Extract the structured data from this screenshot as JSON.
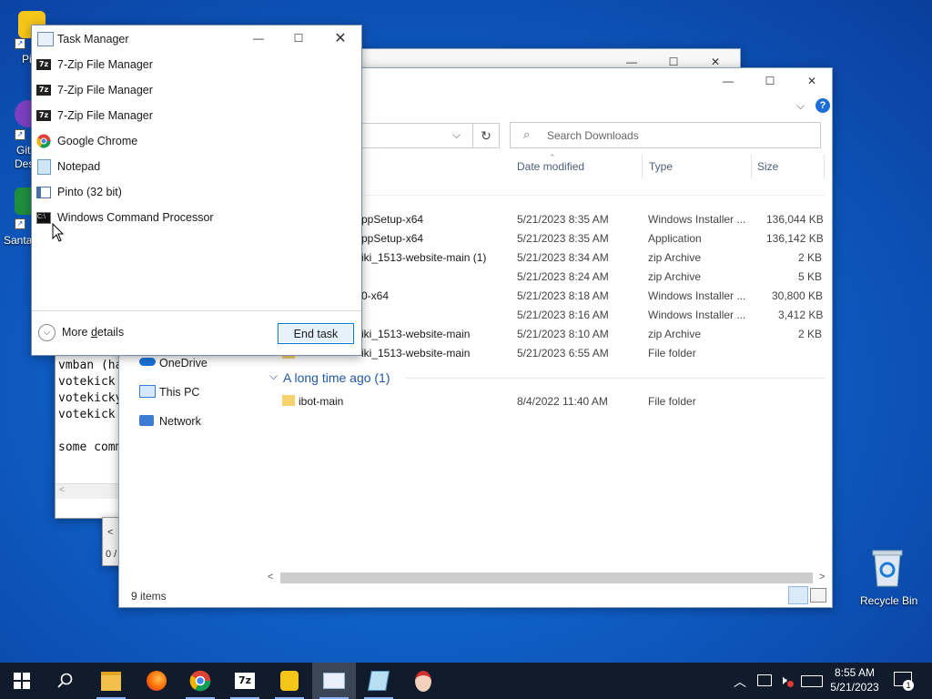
{
  "desktop": {
    "icons": [
      {
        "label": "Pi"
      },
      {
        "label": "Git"
      },
      {
        "label": "Des"
      },
      {
        "label": "Santa"
      },
      {
        "label": "Recycle Bin"
      }
    ]
  },
  "explorer_back": {
    "title": ""
  },
  "notepad": {
    "lines": [
      "vmban (ha",
      "votekick",
      "votekicky",
      "votekick",
      "",
      "some comm"
    ],
    "status": "0 /"
  },
  "explorer": {
    "search_placeholder": "Search Downloads",
    "columns": [
      "Date modified",
      "Type",
      "Size"
    ],
    "rows": [
      {
        "name": "ppSetup-x64",
        "date": "5/21/2023 8:35 AM",
        "type": "Windows Installer ...",
        "size": "136,044 KB"
      },
      {
        "name": "ppSetup-x64",
        "date": "5/21/2023 8:35 AM",
        "type": "Application",
        "size": "136,142 KB"
      },
      {
        "name": "iki_1513-website-main (1)",
        "date": "5/21/2023 8:34 AM",
        "type": "zip Archive",
        "size": "2 KB"
      },
      {
        "name": "",
        "date": "5/21/2023 8:24 AM",
        "type": "zip Archive",
        "size": "5 KB"
      },
      {
        "name": "0-x64",
        "date": "5/21/2023 8:18 AM",
        "type": "Windows Installer ...",
        "size": "30,800 KB"
      },
      {
        "name": "",
        "date": "5/21/2023 8:16 AM",
        "type": "Windows Installer ...",
        "size": "3,412 KB"
      },
      {
        "name": "iki_1513-website-main",
        "date": "5/21/2023 8:10 AM",
        "type": "zip Archive",
        "size": "2 KB"
      },
      {
        "name": "iki_1513-website-main",
        "date": "5/21/2023 6:55 AM",
        "type": "File folder",
        "size": ""
      }
    ],
    "group_label": "A long time ago (1)",
    "group_rows": [
      {
        "name": "ibot-main",
        "date": "8/4/2022 11:40 AM",
        "type": "File folder",
        "size": ""
      }
    ],
    "nav": [
      "OneDrive",
      "This PC",
      "Network"
    ],
    "status": "9 items"
  },
  "task_manager": {
    "title": "Task Manager",
    "apps": [
      {
        "label": "7-Zip File Manager",
        "icon": "7zip-icon"
      },
      {
        "label": "7-Zip File Manager",
        "icon": "7zip-icon"
      },
      {
        "label": "7-Zip File Manager",
        "icon": "7zip-icon"
      },
      {
        "label": "Google Chrome",
        "icon": "chrome-icon"
      },
      {
        "label": "Notepad",
        "icon": "notepad-icon"
      },
      {
        "label": "Pinto (32 bit)",
        "icon": "pinto-icon"
      },
      {
        "label": "Windows Command Processor",
        "icon": "cmd-icon"
      }
    ],
    "more_details_pre": "More ",
    "more_details_ul": "d",
    "more_details_post": "etails",
    "end_task": "End task"
  },
  "taskbar": {
    "clock_time": "8:55 AM",
    "clock_date": "5/21/2023",
    "notification_count": "1"
  }
}
